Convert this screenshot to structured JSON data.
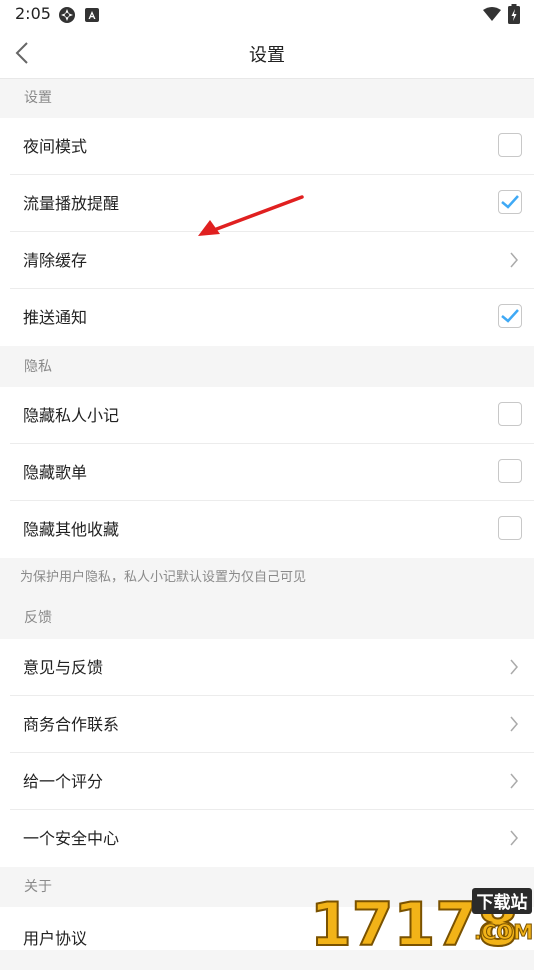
{
  "status": {
    "time": "2:05"
  },
  "header": {
    "title": "设置"
  },
  "sections": {
    "settings": {
      "title": "设置",
      "items": [
        {
          "label": "夜间模式",
          "checked": false
        },
        {
          "label": "流量播放提醒",
          "checked": true
        },
        {
          "label": "清除缓存"
        },
        {
          "label": "推送通知",
          "checked": true
        }
      ]
    },
    "privacy": {
      "title": "隐私",
      "items": [
        {
          "label": "隐藏私人小记",
          "checked": false
        },
        {
          "label": "隐藏歌单",
          "checked": false
        },
        {
          "label": "隐藏其他收藏",
          "checked": false
        }
      ],
      "note": "为保护用户隐私，私人小记默认设置为仅自己可见"
    },
    "feedback": {
      "title": "反馈",
      "items": [
        {
          "label": "意见与反馈"
        },
        {
          "label": "商务合作联系"
        },
        {
          "label": "给一个评分"
        },
        {
          "label": "一个安全中心"
        }
      ]
    },
    "about": {
      "title": "关于",
      "items": [
        {
          "label": "用户协议"
        }
      ]
    }
  },
  "watermark": {
    "number": "17178",
    "badge": "下载站",
    "domain": ".COM"
  },
  "colors": {
    "check": "#3fa9f5",
    "arrow": "#e02020"
  }
}
